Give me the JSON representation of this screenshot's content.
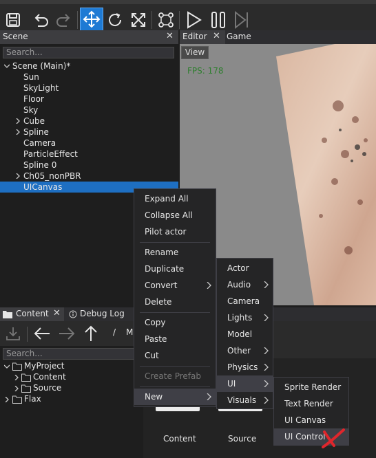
{
  "toolbar": {
    "buttons": [
      {
        "icon": "save-icon"
      },
      {
        "icon": "undo-icon"
      },
      {
        "icon": "redo-icon"
      },
      {
        "icon": "translate-gizmo-icon",
        "active": true
      },
      {
        "icon": "rotate-gizmo-icon"
      },
      {
        "icon": "scale-gizmo-icon"
      },
      {
        "icon": "node-graph-icon"
      },
      {
        "icon": "play-icon"
      },
      {
        "icon": "pause-icon"
      },
      {
        "icon": "step-icon"
      }
    ],
    "accent": "#1e7ad4"
  },
  "scene": {
    "title": "Scene",
    "search_placeholder": "Search...",
    "root": "Scene (Main)*",
    "items": [
      {
        "label": "Sun",
        "expandable": false
      },
      {
        "label": "SkyLight",
        "expandable": false
      },
      {
        "label": "Floor",
        "expandable": false
      },
      {
        "label": "Sky",
        "expandable": false
      },
      {
        "label": "Cube",
        "expandable": true
      },
      {
        "label": "Spline",
        "expandable": true
      },
      {
        "label": "Camera",
        "expandable": false
      },
      {
        "label": "ParticleEffect",
        "expandable": false
      },
      {
        "label": "Spline 0",
        "expandable": false
      },
      {
        "label": "Ch05_nonPBR",
        "expandable": true
      },
      {
        "label": "UICanvas",
        "expandable": false,
        "selected": true
      }
    ]
  },
  "editor": {
    "tabs": [
      "Editor",
      "Game"
    ],
    "view_button": "View",
    "fps": "FPS: 178"
  },
  "content": {
    "tabs": [
      "Content",
      "Debug Log"
    ],
    "path_sep": "/",
    "path_fragment": "M",
    "search_placeholder": "Search...",
    "tree": [
      "MyProject",
      "Content",
      "Source",
      "Flax"
    ],
    "items": [
      "Content",
      "Source"
    ]
  },
  "context_menu": {
    "items": [
      "Expand All",
      "Collapse All",
      "Pilot actor",
      "Rename",
      "Duplicate",
      "Convert",
      "Delete",
      "Copy",
      "Paste",
      "Cut",
      "Create Prefab",
      "New"
    ]
  },
  "new_menu": {
    "items": [
      "Actor",
      "Audio",
      "Camera",
      "Lights",
      "Model",
      "Other",
      "Physics",
      "UI",
      "Visuals"
    ]
  },
  "ui_menu": {
    "items": [
      "Sprite Render",
      "Text Render",
      "UI Canvas",
      "UI Control"
    ]
  },
  "colors": {
    "selection": "#1e6fc2",
    "menu_bg": "#252526",
    "menu_highlight": "#3f3f46",
    "fps_text": "#2f7f2f",
    "mark": "#e0262c"
  }
}
